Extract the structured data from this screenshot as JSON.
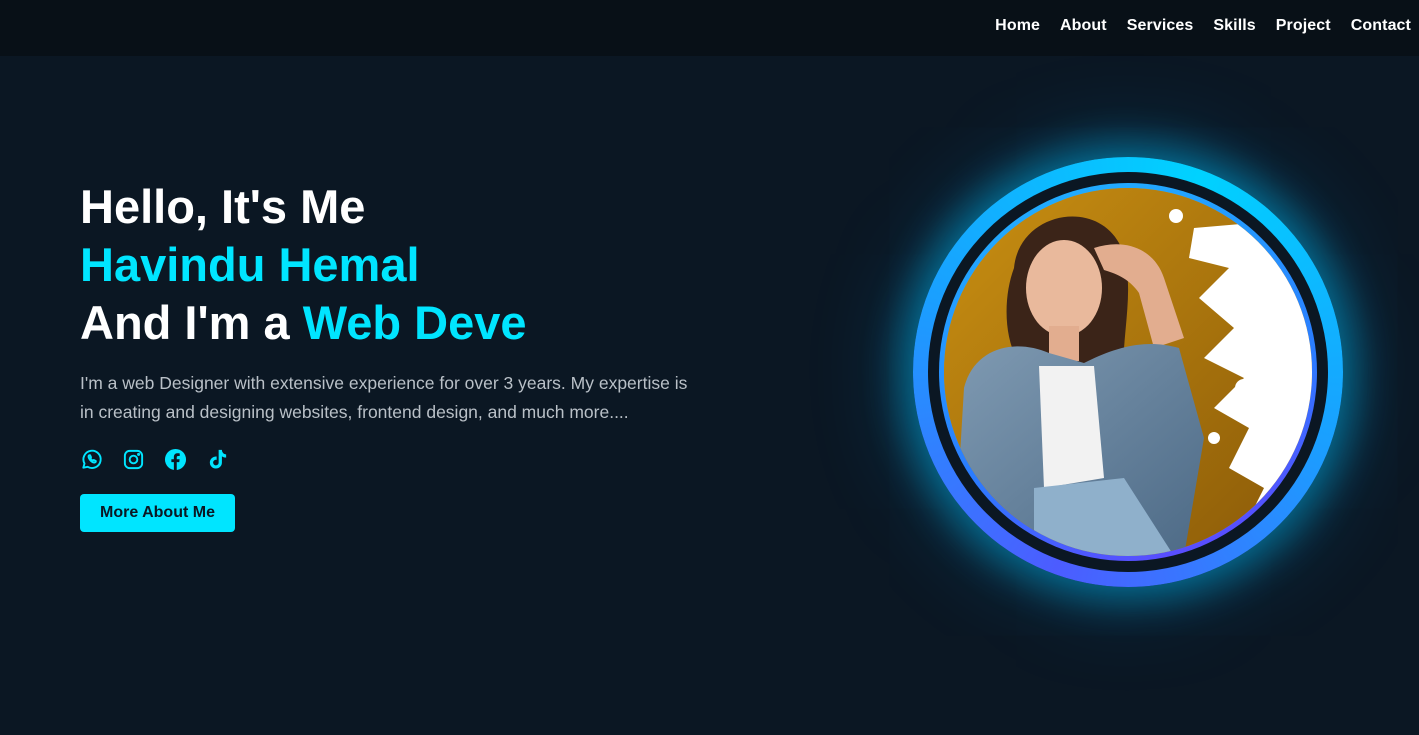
{
  "nav": {
    "links": [
      "Home",
      "About",
      "Services",
      "Skills",
      "Project",
      "Contact"
    ]
  },
  "hero": {
    "greeting": "Hello, It's Me",
    "name": "Havindu Hemal",
    "role_prefix": "And I'm a",
    "role_typed": "Web Deve",
    "description": "I'm a web Designer with extensive experience for over 3 years. My expertise is in creating and designing websites, frontend design, and much more....",
    "cta_label": "More About Me",
    "socials": [
      "whatsapp-icon",
      "instagram-icon",
      "facebook-icon",
      "tiktok-icon"
    ]
  },
  "colors": {
    "background": "#0b1723",
    "navbar": "#081017",
    "accent": "#00e5ff",
    "text_muted": "#b9c0c7"
  }
}
